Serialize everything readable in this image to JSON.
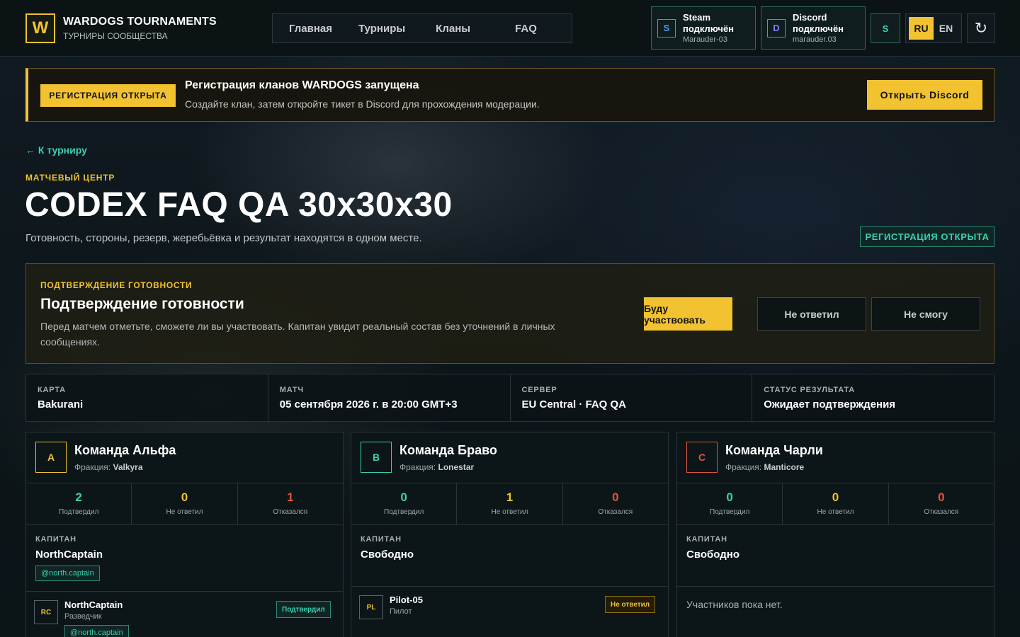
{
  "header": {
    "logo": "W",
    "title": "WARDOGS TOURNAMENTS",
    "subtitle": "ТУРНИРЫ СООБЩЕСТВА",
    "nav": [
      "Главная",
      "Турниры",
      "Кланы",
      "FAQ"
    ],
    "steam": {
      "icon": "S",
      "line1": "Steam",
      "line2": "подключён",
      "user": "Marauder-03"
    },
    "discord": {
      "icon": "D",
      "line1": "Discord",
      "line2": "подключён",
      "user": "marauder.03"
    },
    "profile_icon": "S",
    "lang": {
      "active": "RU",
      "other": "EN"
    },
    "refresh_icon": "↻"
  },
  "banner": {
    "badge": "РЕГИСТРАЦИЯ ОТКРЫТА",
    "title": "Регистрация кланов WARDOGS запущена",
    "desc": "Создайте клан, затем откройте тикет в Discord для прохождения модерации.",
    "button": "Открыть Discord"
  },
  "page": {
    "back": "← К турниру",
    "eyebrow": "МАТЧЕВЫЙ ЦЕНТР",
    "title": "CODEX FAQ QA 30x30x30",
    "subtitle": "Готовность, стороны, резерв, жеребьёвка и результат находятся в одном месте.",
    "status_badge": "РЕГИСТРАЦИЯ ОТКРЫТА"
  },
  "ready": {
    "eyebrow": "ПОДТВЕРЖДЕНИЕ ГОТОВНОСТИ",
    "title": "Подтверждение готовности",
    "desc": "Перед матчем отметьте, сможете ли вы участвовать. Капитан увидит реальный состав без уточнений в личных сообщениях.",
    "btn_yes": "Буду участвовать",
    "btn_none": "Не ответил",
    "btn_no": "Не смогу"
  },
  "info": [
    {
      "k": "КАРТА",
      "v": "Bakurani"
    },
    {
      "k": "МАТЧ",
      "v": "05 сентября 2026 г. в 20:00 GMT+3"
    },
    {
      "k": "СЕРВЕР",
      "v": "EU Central · FAQ QA"
    },
    {
      "k": "СТАТУС РЕЗУЛЬТАТА",
      "v": "Ожидает подтверждения"
    }
  ],
  "colors": {
    "accent": "#f2c230",
    "teal": "#3fcfb2",
    "red": "#e0553f"
  },
  "teams": [
    {
      "letter": "A",
      "name": "Команда Альфа",
      "faction_label": "Фракция:",
      "faction": "Valkyra",
      "stats": [
        {
          "n": "2",
          "l": "Подтвердил"
        },
        {
          "n": "0",
          "l": "Не ответил"
        },
        {
          "n": "1",
          "l": "Отказался"
        }
      ],
      "cap_label": "КАПИТАН",
      "captain": "NorthCaptain",
      "cap_tag": "@north.captain",
      "member": {
        "init": "RC",
        "name": "NorthCaptain",
        "role": "Разведчик",
        "status": "Подтвердил",
        "tag": "@north.captain"
      }
    },
    {
      "letter": "B",
      "name": "Команда Браво",
      "faction_label": "Фракция:",
      "faction": "Lonestar",
      "stats": [
        {
          "n": "0",
          "l": "Подтвердил"
        },
        {
          "n": "1",
          "l": "Не ответил"
        },
        {
          "n": "0",
          "l": "Отказался"
        }
      ],
      "cap_label": "КАПИТАН",
      "captain": "Свободно",
      "member": {
        "init": "PL",
        "name": "Pilot-05",
        "role": "Пилот",
        "status": "Не ответил"
      }
    },
    {
      "letter": "C",
      "name": "Команда Чарли",
      "faction_label": "Фракция:",
      "faction": "Manticore",
      "stats": [
        {
          "n": "0",
          "l": "Подтвердил"
        },
        {
          "n": "0",
          "l": "Не ответил"
        },
        {
          "n": "0",
          "l": "Отказался"
        }
      ],
      "cap_label": "КАПИТАН",
      "captain": "Свободно",
      "empty": "Участников пока нет."
    }
  ]
}
